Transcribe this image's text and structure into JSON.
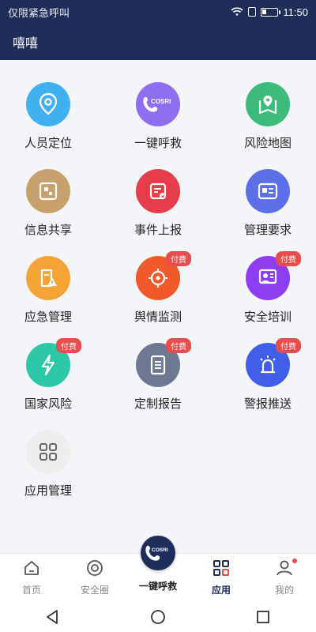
{
  "status": {
    "carrier": "仅限紧急呼叫",
    "time": "11:50"
  },
  "appbar": {
    "title": "嘻嘻"
  },
  "apps": [
    {
      "label": "人员定位",
      "icon": "location-pin-icon",
      "color": "#3fb0f0",
      "badge": ""
    },
    {
      "label": "一键呼救",
      "icon": "cosri-phone-icon",
      "color": "#8f6df0",
      "badge": ""
    },
    {
      "label": "风险地图",
      "icon": "map-pin-icon",
      "color": "#3dbb7a",
      "badge": ""
    },
    {
      "label": "信息共享",
      "icon": "share-card-icon",
      "color": "#c7a06b",
      "badge": ""
    },
    {
      "label": "事件上报",
      "icon": "report-icon",
      "color": "#e53d4a",
      "badge": ""
    },
    {
      "label": "管理要求",
      "icon": "id-card-icon",
      "color": "#5b6fe8",
      "badge": ""
    },
    {
      "label": "应急管理",
      "icon": "warning-doc-icon",
      "color": "#f4a335",
      "badge": ""
    },
    {
      "label": "舆情监测",
      "icon": "crosshair-icon",
      "color": "#f05a2b",
      "badge": "付费"
    },
    {
      "label": "安全培训",
      "icon": "trainer-icon",
      "color": "#8e3df0",
      "badge": "付费"
    },
    {
      "label": "国家风险",
      "icon": "lightning-icon",
      "color": "#2cc7a8",
      "badge": "付费"
    },
    {
      "label": "定制报告",
      "icon": "document-icon",
      "color": "#6d7893",
      "badge": "付费"
    },
    {
      "label": "警报推送",
      "icon": "alarm-light-icon",
      "color": "#3f5fe8",
      "badge": "付费"
    },
    {
      "label": "应用管理",
      "icon": "grid-apps-icon",
      "color": "#eeeeee",
      "badge": ""
    }
  ],
  "tabs": [
    {
      "label": "首页",
      "icon": "home-icon"
    },
    {
      "label": "安全圈",
      "icon": "target-circle-icon"
    },
    {
      "label": "一键呼救",
      "icon": "cosri-phone-icon"
    },
    {
      "label": "应用",
      "icon": "grid-apps-icon"
    },
    {
      "label": "我的",
      "icon": "person-icon"
    }
  ],
  "cosri_text": "COSRI"
}
